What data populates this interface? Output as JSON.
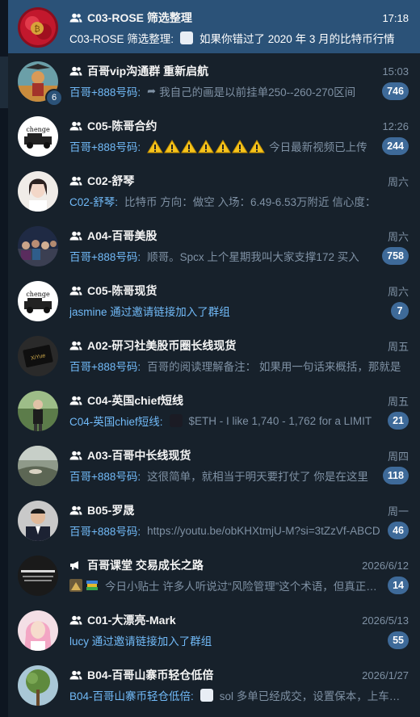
{
  "chats": [
    {
      "title": "C03-ROSE 筛选整理",
      "time": "17:18",
      "sender": "C03-ROSE 筛选整理:",
      "message": "如果你错过了 2020 年 3 月的比特币行情",
      "badge": "",
      "active": true,
      "avatar": "rose",
      "prefix": "thumb"
    },
    {
      "title": "百哥vip沟通群 重新启航",
      "time": "15:03",
      "sender": "百哥+888号码:",
      "message": "我自己的画是以前挂单250--260-270区间",
      "badge": "746",
      "avatar_badge": "6",
      "avatar": "pirate",
      "prefix": "forward"
    },
    {
      "title": "C05-陈哥合约",
      "time": "12:26",
      "sender": "百哥+888号码:",
      "message": "今日最新视频已上传",
      "badge": "244",
      "avatar": "chenge",
      "prefix": "warnings"
    },
    {
      "title": "C02-舒琴",
      "time": "周六",
      "sender": "C02-舒琴:",
      "message": "比特币 方向：做空 入场：6.49-6.53万附近 信心度：",
      "badge": "",
      "avatar": "woman"
    },
    {
      "title": "A04-百哥美股",
      "time": "周六",
      "sender": "百哥+888号码:",
      "message": "顺哥。Spcx 上个星期我叫大家支撑172 买入",
      "badge": "758",
      "avatar": "crowd"
    },
    {
      "title": "C05-陈哥现货",
      "time": "周六",
      "sender": "",
      "message": "jasmine 通过邀请链接加入了群组",
      "badge": "7",
      "avatar": "chenge",
      "system": true
    },
    {
      "title": "A02-研习社美股币圈长线现货",
      "time": "周五",
      "sender": "百哥+888号码:",
      "message": "百哥的阅读理解备注：  如果用一句话来概括，那就是",
      "badge": "",
      "avatar": "card"
    },
    {
      "title": "C04-英国chief短线",
      "time": "周五",
      "sender": "C04-英国chief短线:",
      "message": "$ETH - I like 1,740 - 1,762 for a LIMIT",
      "badge": "21",
      "avatar": "person2",
      "prefix": "darkthumb"
    },
    {
      "title": "A03-百哥中长线现货",
      "time": "周四",
      "sender": "百哥+888号码:",
      "message": "这很简单，就相当于明天要打仗了 你是在这里",
      "badge": "118",
      "avatar": "landscape"
    },
    {
      "title": "B05-罗晟",
      "time": "周一",
      "sender": "百哥+888号码:",
      "message": "https://youtu.be/obKHXtmjU-M?si=3tZzVf-ABCD",
      "badge": "46",
      "avatar": "man"
    },
    {
      "title": "百哥课堂 交易成长之路",
      "time": "2026/6/12",
      "sender": "",
      "message": "今日小贴士  许多人听说过“风险管理”这个术语，但真正理解",
      "badge": "14",
      "avatar": "dark",
      "channel": true,
      "prefix": "emojis"
    },
    {
      "title": "C01-大漂亮-Mark",
      "time": "2026/5/13",
      "sender": "",
      "message": "lucy 通过邀请链接加入了群组",
      "badge": "55",
      "avatar": "pink",
      "system": true
    },
    {
      "title": "B04-百哥山寨币轻仓低倍",
      "time": "2026/1/27",
      "sender": "B04-百哥山寨币轻仓低倍:",
      "message": "sol 多单已经成交，设置保本，上车的朋友",
      "badge": "",
      "avatar": "tree",
      "prefix": "thumb"
    }
  ]
}
